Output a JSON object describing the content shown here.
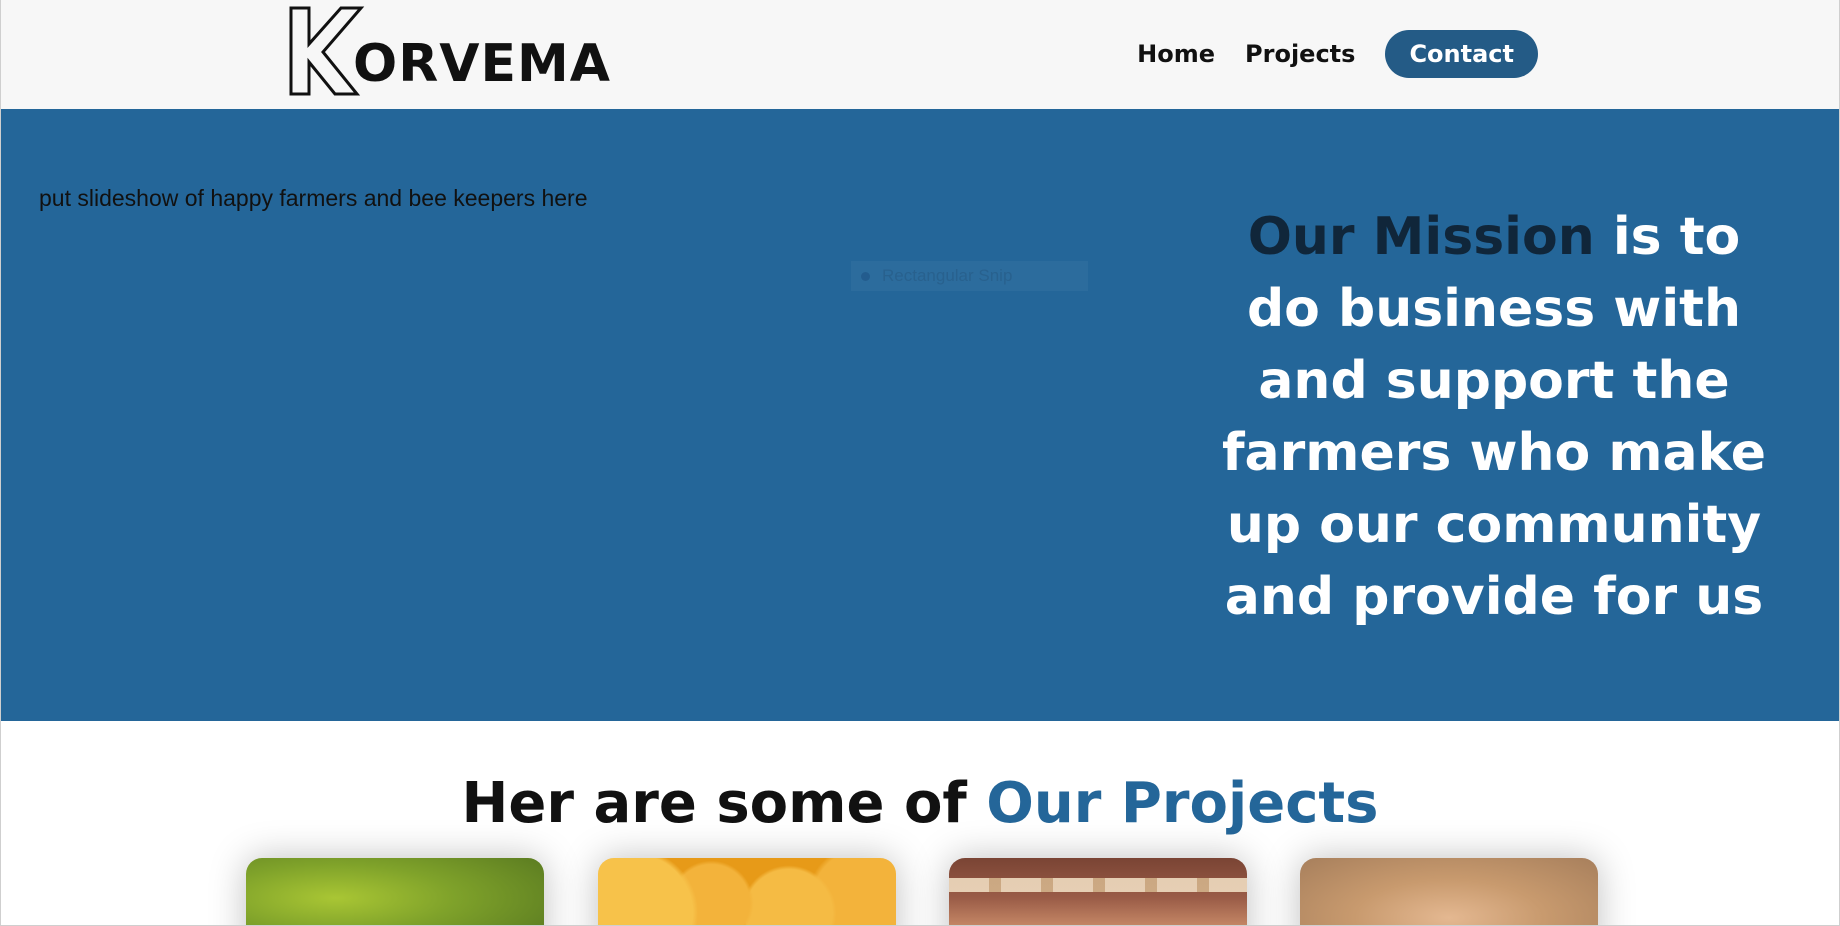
{
  "brand": {
    "logo_initial": "K",
    "logo_rest": "ORVEMA"
  },
  "nav": {
    "home": "Home",
    "projects": "Projects",
    "contact": "Contact"
  },
  "hero": {
    "placeholder_note": "put slideshow of happy farmers and bee keepers here",
    "tooltip_label": "Rectangular Snip",
    "mission_highlight": "Our Mission",
    "mission_text": " is to do business with and support the farmers who make up our community and provide for us"
  },
  "projects": {
    "heading_prefix": "Her are some of ",
    "heading_accent": "Our Projects",
    "cards": [
      "green-leaf-photo",
      "honeycomb-photo",
      "basket-photo",
      "bee-keeper-photo"
    ]
  },
  "colors": {
    "brand_blue": "#246699",
    "header_bg": "#f7f7f7",
    "contact_button": "#245b86"
  }
}
